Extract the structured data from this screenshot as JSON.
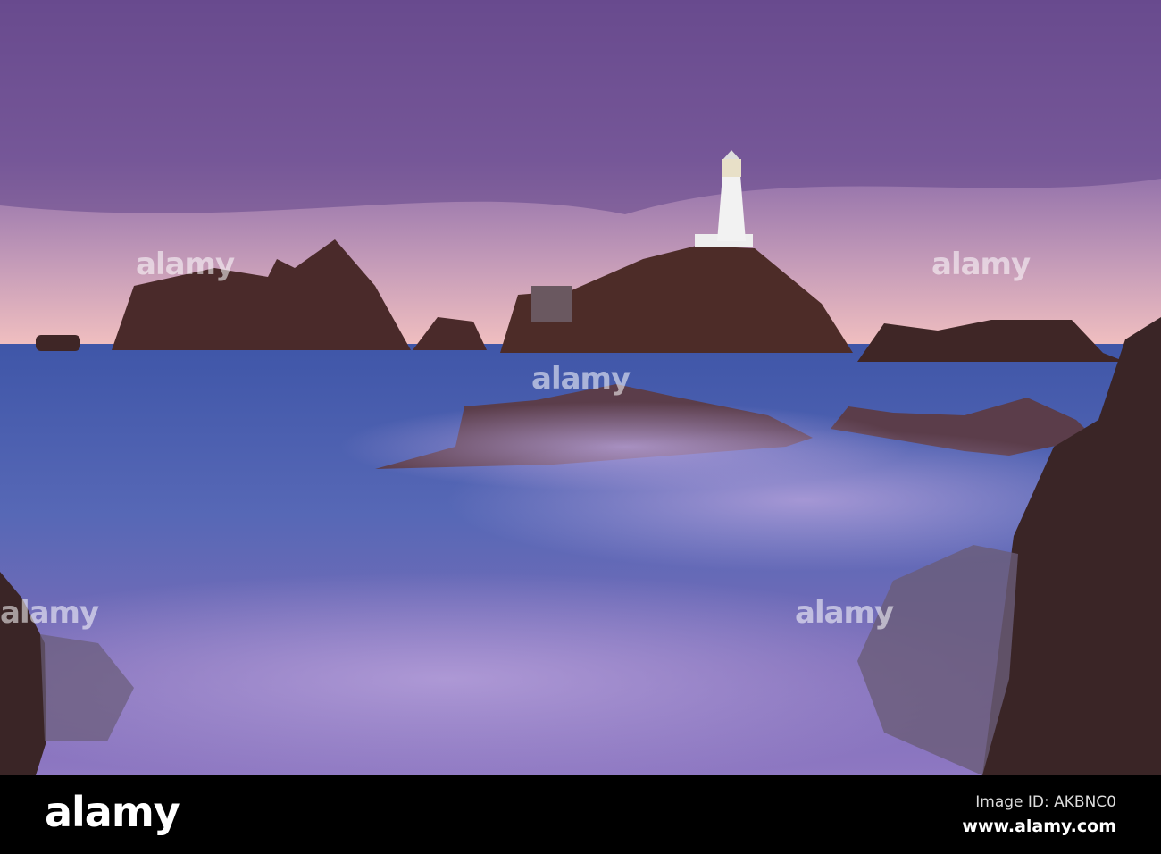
{
  "photo": {
    "subject": "lighthouse-seascape"
  },
  "watermark": {
    "text": "alamy"
  },
  "footer": {
    "logo": "alamy",
    "image_id": "Image ID: AKBNC0",
    "site": "www.alamy.com"
  }
}
